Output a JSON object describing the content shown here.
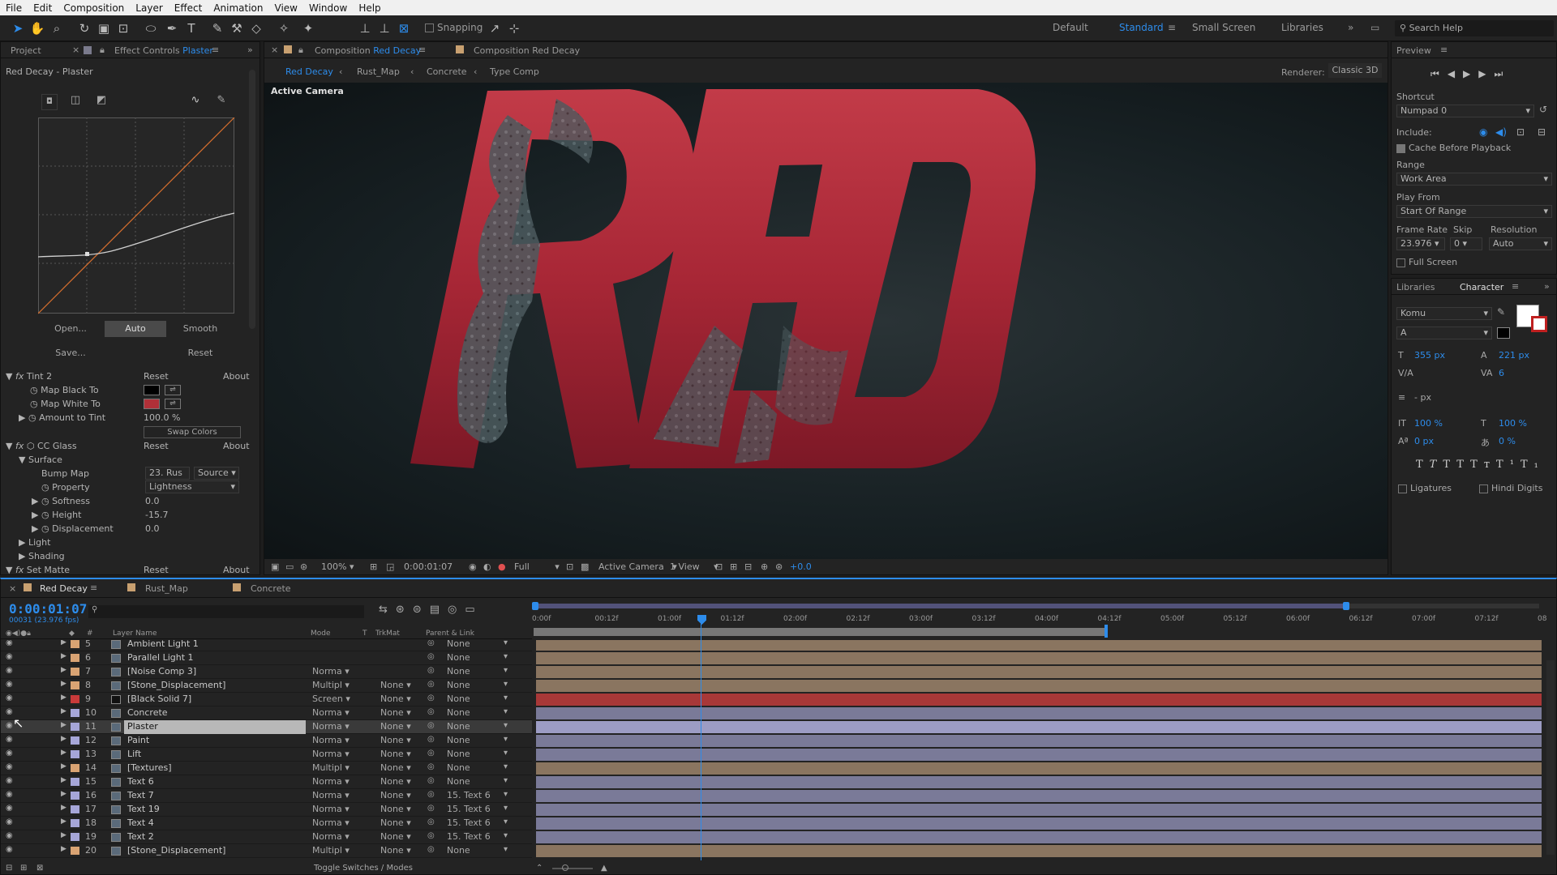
{
  "menu": [
    "File",
    "Edit",
    "Composition",
    "Layer",
    "Effect",
    "Animation",
    "View",
    "Window",
    "Help"
  ],
  "toolbar": {
    "snapping": "Snapping",
    "workspaces": [
      "Default",
      "Standard",
      "Small Screen",
      "Libraries"
    ],
    "search": "Search Help"
  },
  "effect_panel": {
    "tab_project": "Project",
    "tab_effect": "Effect Controls",
    "tab_effect_target": "Plaster",
    "path": "Red Decay - Plaster",
    "curve_buttons": [
      "Open...",
      "Auto",
      "Smooth",
      "Save...",
      "Reset"
    ],
    "tint": {
      "name": "Tint 2",
      "reset": "Reset",
      "about": "About",
      "map_black": "Map Black To",
      "map_white": "Map White To",
      "amount": "Amount to Tint",
      "amount_val": "100.0 %",
      "swap": "Swap Colors"
    },
    "ccglass": {
      "name": "CC Glass",
      "reset": "Reset",
      "about": "About",
      "surface": "Surface",
      "bump_map": "Bump Map",
      "bump_val": "23. Rus",
      "bump_src": "Source",
      "property": "Property",
      "property_val": "Lightness",
      "softness": "Softness",
      "softness_val": "0.0",
      "height": "Height",
      "height_val": "-15.7",
      "displacement": "Displacement",
      "displacement_val": "0.0",
      "light": "Light",
      "shading": "Shading"
    },
    "setmatte": {
      "name": "Set Matte",
      "reset": "Reset",
      "about": "About"
    }
  },
  "comp": {
    "tab_prefix": "Composition",
    "tab_name": "Red Decay",
    "tab2": "Composition Red Decay",
    "breadcrumbs": [
      "Red Decay",
      "Rust_Map",
      "Concrete",
      "Type Comp"
    ],
    "renderer_label": "Renderer:",
    "renderer": "Classic 3D",
    "active_camera": "Active Camera",
    "text": "RED",
    "bottom": {
      "zoom": "100%",
      "time": "0:00:01:07",
      "res": "Full",
      "camera": "Active Camera",
      "view": "1 View",
      "exposure": "+0.0"
    }
  },
  "preview": {
    "title": "Preview",
    "shortcut_label": "Shortcut",
    "shortcut": "Numpad 0",
    "include": "Include:",
    "cache": "Cache Before Playback",
    "range_label": "Range",
    "range": "Work Area",
    "playfrom_label": "Play From",
    "playfrom": "Start Of Range",
    "framerate_label": "Frame Rate",
    "skip_label": "Skip",
    "res_label": "Resolution",
    "framerate": "23.976",
    "skip": "0",
    "res": "Auto",
    "fullscreen": "Full Screen"
  },
  "character": {
    "tab_libraries": "Libraries",
    "tab_character": "Character",
    "font": "Komu",
    "style": "A",
    "size": "355 px",
    "leading": "221 px",
    "kerning": "",
    "tracking": "6",
    "stroke": "- px",
    "vscale": "100 %",
    "hscale": "100 %",
    "baseline": "0 px",
    "tsume": "0 %",
    "ligatures": "Ligatures",
    "hindi": "Hindi Digits"
  },
  "timeline": {
    "tabs": [
      "Red Decay",
      "Rust_Map",
      "Concrete"
    ],
    "timecode": "0:00:01:07",
    "fps": "00031 (23.976 fps)",
    "col_layer": "Layer Name",
    "col_mode": "Mode",
    "col_t": "T",
    "col_trk": "TrkMat",
    "col_parent": "Parent & Link",
    "toggle": "Toggle Switches / Modes",
    "ruler": [
      "0:00f",
      "00:12f",
      "01:00f",
      "01:12f",
      "02:00f",
      "02:12f",
      "03:00f",
      "03:12f",
      "04:00f",
      "04:12f",
      "05:00f",
      "05:12f",
      "06:00f",
      "06:12f",
      "07:00f",
      "07:12f",
      "08"
    ],
    "layers": [
      {
        "num": "5",
        "name": "Ambient Light 1",
        "mode": "",
        "trk": "",
        "parent": "None",
        "color": "#d9a373",
        "bar": "#8a7560",
        "type": "light"
      },
      {
        "num": "6",
        "name": "Parallel Light 1",
        "mode": "",
        "trk": "",
        "parent": "None",
        "color": "#d9a373",
        "bar": "#8a7560",
        "type": "light"
      },
      {
        "num": "7",
        "name": "[Noise Comp 3]",
        "mode": "Norma",
        "trk": "",
        "parent": "None",
        "color": "#d9a373",
        "bar": "#8a7560",
        "type": "comp"
      },
      {
        "num": "8",
        "name": "[Stone_Displacement]",
        "mode": "Multipl",
        "trk": "None",
        "parent": "None",
        "color": "#d9a373",
        "bar": "#8a7560",
        "type": "comp"
      },
      {
        "num": "9",
        "name": "[Black Solid 7]",
        "mode": "Screen",
        "trk": "None",
        "parent": "None",
        "color": "#c83a3a",
        "bar": "#a83838",
        "type": "solid"
      },
      {
        "num": "10",
        "name": "Concrete",
        "mode": "Norma",
        "trk": "None",
        "parent": "None",
        "color": "#a6a6d8",
        "bar": "#7a7a98",
        "type": "comp"
      },
      {
        "num": "11",
        "name": "Plaster",
        "mode": "Norma",
        "trk": "None",
        "parent": "None",
        "color": "#a6a6d8",
        "bar": "#9c9cc4",
        "type": "comp",
        "selected": true
      },
      {
        "num": "12",
        "name": "Paint",
        "mode": "Norma",
        "trk": "None",
        "parent": "None",
        "color": "#a6a6d8",
        "bar": "#7a7a98",
        "type": "comp"
      },
      {
        "num": "13",
        "name": "Lift",
        "mode": "Norma",
        "trk": "None",
        "parent": "None",
        "color": "#a6a6d8",
        "bar": "#7a7a98",
        "type": "comp"
      },
      {
        "num": "14",
        "name": "[Textures]",
        "mode": "Multipl",
        "trk": "None",
        "parent": "None",
        "color": "#d9a373",
        "bar": "#8a7560",
        "type": "comp"
      },
      {
        "num": "15",
        "name": "Text 6",
        "mode": "Norma",
        "trk": "None",
        "parent": "None",
        "color": "#a6a6d8",
        "bar": "#7a7a98",
        "type": "comp"
      },
      {
        "num": "16",
        "name": "Text 7",
        "mode": "Norma",
        "trk": "None",
        "parent": "15. Text 6",
        "color": "#a6a6d8",
        "bar": "#7a7a98",
        "type": "comp"
      },
      {
        "num": "17",
        "name": "Text 19",
        "mode": "Norma",
        "trk": "None",
        "parent": "15. Text 6",
        "color": "#a6a6d8",
        "bar": "#7a7a98",
        "type": "comp"
      },
      {
        "num": "18",
        "name": "Text 4",
        "mode": "Norma",
        "trk": "None",
        "parent": "15. Text 6",
        "color": "#a6a6d8",
        "bar": "#7a7a98",
        "type": "comp"
      },
      {
        "num": "19",
        "name": "Text 2",
        "mode": "Norma",
        "trk": "None",
        "parent": "15. Text 6",
        "color": "#a6a6d8",
        "bar": "#7a7a98",
        "type": "comp"
      },
      {
        "num": "20",
        "name": "[Stone_Displacement]",
        "mode": "Multipl",
        "trk": "None",
        "parent": "None",
        "color": "#d9a373",
        "bar": "#8a7560",
        "type": "comp"
      }
    ]
  }
}
